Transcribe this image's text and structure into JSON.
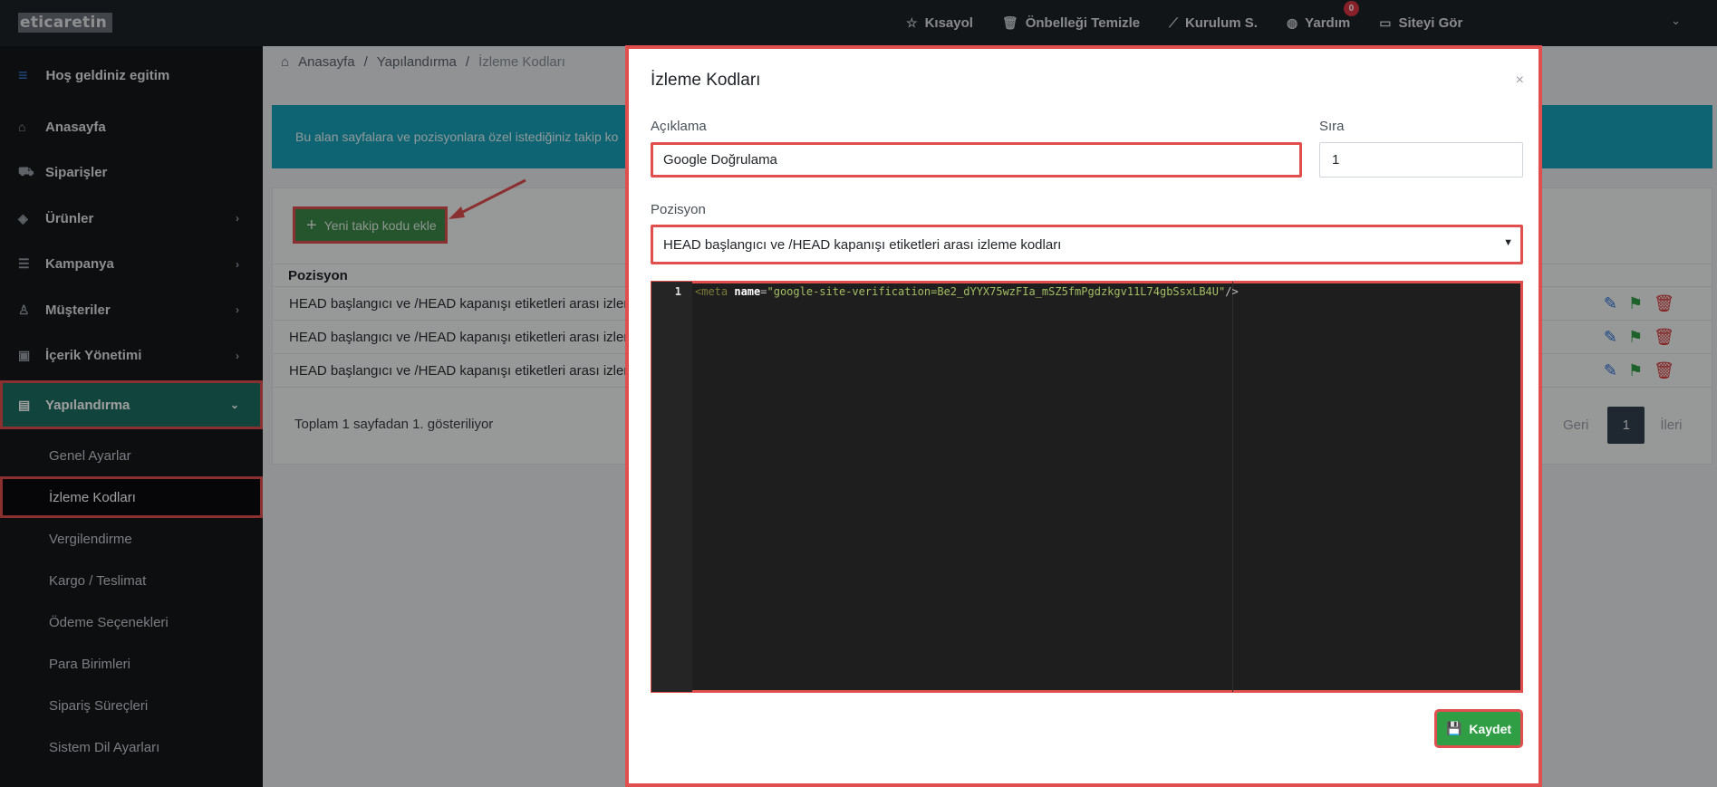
{
  "topbar": {
    "logo": "eticaretin",
    "items": [
      {
        "icon": "star-icon",
        "label": "Kısayol"
      },
      {
        "icon": "trash-icon",
        "label": "Önbelleği Temizle"
      },
      {
        "icon": "magic-wand-icon",
        "label": "Kurulum S."
      },
      {
        "icon": "globe-icon",
        "label": "Yardım",
        "badge": "0"
      },
      {
        "icon": "monitor-icon",
        "label": "Siteyi Gör"
      }
    ]
  },
  "sidebar": {
    "welcome": "Hoş geldiniz egitim",
    "items": [
      {
        "label": "Anasayfa",
        "icon": "home-icon"
      },
      {
        "label": "Siparişler",
        "icon": "cart-icon"
      },
      {
        "label": "Ürünler",
        "icon": "tag-icon"
      },
      {
        "label": "Kampanya",
        "icon": "list-icon"
      },
      {
        "label": "Müşteriler",
        "icon": "user-icon"
      },
      {
        "label": "İçerik Yönetimi",
        "icon": "content-icon"
      },
      {
        "label": "Yapılandırma",
        "icon": "settings-list-icon"
      }
    ],
    "subitems": [
      "Genel Ayarlar",
      "İzleme Kodları",
      "Vergilendirme",
      "Kargo / Teslimat",
      "Ödeme Seçenekleri",
      "Para Birimleri",
      "Sipariş Süreçleri",
      "Sistem Dil Ayarları"
    ]
  },
  "breadcrumb": [
    "Anasayfa",
    "Yapılandırma",
    "İzleme Kodları"
  ],
  "info_text": "Bu alan sayfalara ve pozisyonlara özel istediğiniz takip ko",
  "add_button": "Yeni takip kodu ekle",
  "table": {
    "header": "Pozisyon",
    "rows": [
      "HEAD başlangıcı ve /HEAD kapanışı etiketleri arası izleme",
      "HEAD başlangıcı ve /HEAD kapanışı etiketleri arası izleme",
      "HEAD başlangıcı ve /HEAD kapanışı etiketleri arası izleme"
    ]
  },
  "footer": {
    "summary": "Toplam 1 sayfadan 1. gösteriliyor",
    "prev": "Geri",
    "page": "1",
    "next": "İleri"
  },
  "modal": {
    "title": "İzleme Kodları",
    "close": "×",
    "description_label": "Açıklama",
    "description_value": "Google Doğrulama",
    "order_label": "Sıra",
    "order_value": "1",
    "position_label": "Pozisyon",
    "position_value": "HEAD başlangıcı ve /HEAD kapanışı etiketleri arası izleme kodları",
    "editor": {
      "line_number": "1",
      "tag": "<meta",
      "attr": "name",
      "eq": "=",
      "value": "\"google-site-verification=Be2_dYYX75wzFIa_mSZ5fmPgdzkgv11L74gbSsxLB4U\"",
      "close": "/>"
    },
    "save_button": "Kaydet"
  },
  "colors": {
    "highlight": "#e04e4e",
    "sidebar_active": "#1c6e63",
    "info": "#17a2b8",
    "save": "#2f9e44"
  }
}
